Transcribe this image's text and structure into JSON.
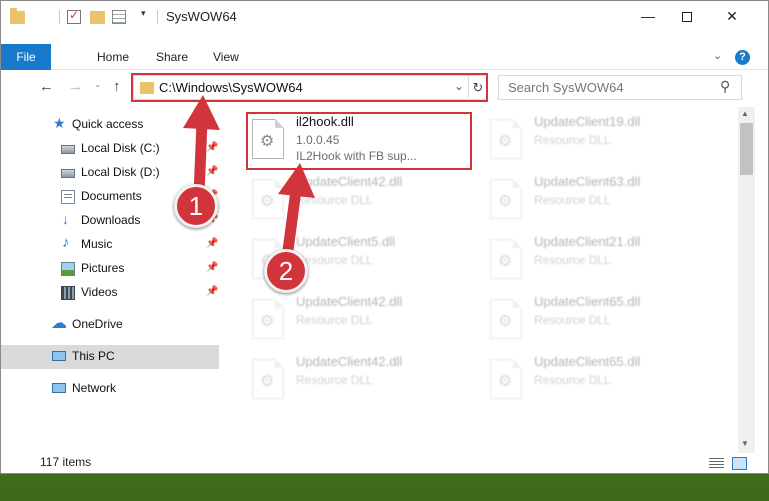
{
  "window": {
    "title": "SysWOW64",
    "qa_dropdown": "▾",
    "minimize": "—",
    "close": "✕"
  },
  "ribbon": {
    "tabs": [
      "File",
      "Home",
      "Share",
      "View"
    ],
    "collapse": "⌄",
    "help": "?"
  },
  "nav": {
    "back": "←",
    "forward": "→",
    "recent": "⌄",
    "up": "↑",
    "address": "C:\\Windows\\SysWOW64",
    "address_dropdown": "⌄",
    "refresh": "↻",
    "search_placeholder": "Search SysWOW64",
    "search_glyph": "⚲"
  },
  "sidebar": {
    "items": [
      {
        "label": "Quick access",
        "icon": "star-icon",
        "glyph": "★"
      },
      {
        "label": "Local Disk (C:)",
        "icon": "drive-icon",
        "pinned": true
      },
      {
        "label": "Local Disk (D:)",
        "icon": "drive-icon",
        "pinned": true
      },
      {
        "label": "Documents",
        "icon": "documents-icon",
        "pinned": true
      },
      {
        "label": "Downloads",
        "icon": "download-icon",
        "glyph": "↓",
        "pinned": true
      },
      {
        "label": "Music",
        "icon": "music-icon",
        "glyph": "♪",
        "pinned": true
      },
      {
        "label": "Pictures",
        "icon": "pictures-icon",
        "pinned": true
      },
      {
        "label": "Videos",
        "icon": "videos-icon",
        "pinned": true
      },
      {
        "label": "OneDrive",
        "icon": "cloud-icon",
        "glyph": "☁"
      },
      {
        "label": "This PC",
        "icon": "computer-icon",
        "selected": true
      },
      {
        "label": "Network",
        "icon": "network-icon"
      }
    ],
    "pin_glyph": "📌"
  },
  "files": {
    "gear_glyph": "⚙",
    "highlighted": {
      "name": "il2hook.dll",
      "version": "1.0.0.45",
      "description": "IL2Hook with FB sup..."
    },
    "faded": [
      {
        "name": "UpdateClient19.dll",
        "type": "Resource DLL"
      },
      {
        "name": "UpdateClient42.dll",
        "type": "Resource DLL"
      },
      {
        "name": "UpdateClient63.dll",
        "type": "Resource DLL"
      },
      {
        "name": "UpdateClient5.dll",
        "type": "Resource DLL"
      },
      {
        "name": "UpdateClient21.dll",
        "type": "Resource DLL"
      },
      {
        "name": "UpdateClient42.dll",
        "type": "Resource DLL"
      },
      {
        "name": "UpdateClient65.dll",
        "type": "Resource DLL"
      },
      {
        "name": "UpdateClient42.dll",
        "type": "Resource DLL"
      },
      {
        "name": "UpdateClient65.dll",
        "type": "Resource DLL"
      }
    ]
  },
  "scrollbar": {
    "up": "▲",
    "down": "▼"
  },
  "status": {
    "item_count": "117 items"
  },
  "annotations": {
    "badge_1": "1",
    "badge_2": "2",
    "color": "#d2343c"
  },
  "colors": {
    "accent": "#1979ca",
    "highlight": "#d2343c",
    "selection": "#dadada"
  }
}
